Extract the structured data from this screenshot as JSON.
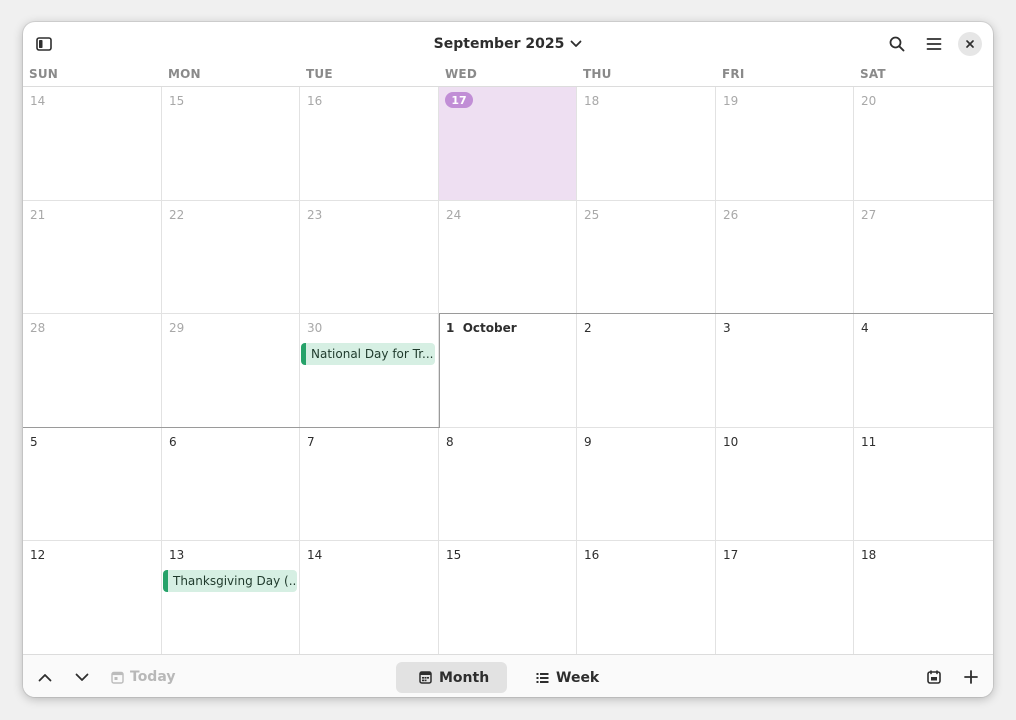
{
  "header": {
    "title": "September 2025"
  },
  "weekdays": [
    "SUN",
    "MON",
    "TUE",
    "WED",
    "THU",
    "FRI",
    "SAT"
  ],
  "weeks": [
    [
      {
        "day": "14",
        "outside": true
      },
      {
        "day": "15",
        "outside": true
      },
      {
        "day": "16",
        "outside": true
      },
      {
        "day": "17",
        "outside": true,
        "today": true
      },
      {
        "day": "18",
        "outside": true
      },
      {
        "day": "19",
        "outside": true
      },
      {
        "day": "20",
        "outside": true
      }
    ],
    [
      {
        "day": "21",
        "outside": true
      },
      {
        "day": "22",
        "outside": true
      },
      {
        "day": "23",
        "outside": true
      },
      {
        "day": "24",
        "outside": true
      },
      {
        "day": "25",
        "outside": true
      },
      {
        "day": "26",
        "outside": true
      },
      {
        "day": "27",
        "outside": true
      }
    ],
    [
      {
        "day": "28",
        "outside": true
      },
      {
        "day": "29",
        "outside": true
      },
      {
        "day": "30",
        "outside": true,
        "event": "National Day for Tr..."
      },
      {
        "day": "1  October",
        "bold": true
      },
      {
        "day": "2"
      },
      {
        "day": "3"
      },
      {
        "day": "4"
      }
    ],
    [
      {
        "day": "5"
      },
      {
        "day": "6"
      },
      {
        "day": "7"
      },
      {
        "day": "8"
      },
      {
        "day": "9"
      },
      {
        "day": "10"
      },
      {
        "day": "11"
      }
    ],
    [
      {
        "day": "12"
      },
      {
        "day": "13",
        "event": "Thanksgiving Day (..."
      },
      {
        "day": "14"
      },
      {
        "day": "15"
      },
      {
        "day": "16"
      },
      {
        "day": "17"
      },
      {
        "day": "18"
      }
    ]
  ],
  "footer": {
    "today_label": "Today",
    "month_label": "Month",
    "week_label": "Week"
  },
  "icons": {
    "sidebar": "sidebar-toggle-icon",
    "search": "search-icon",
    "menu": "hamburger-menu-icon",
    "close": "close-icon",
    "prev": "chevron-up-icon",
    "next": "chevron-down-icon",
    "add": "plus-icon",
    "calendar": "calendar-icon"
  },
  "colors": {
    "today_bg": "#eedff2",
    "today_pill": "#c18ed6",
    "event_bg": "#d6efe3",
    "event_accent": "#26a269"
  }
}
